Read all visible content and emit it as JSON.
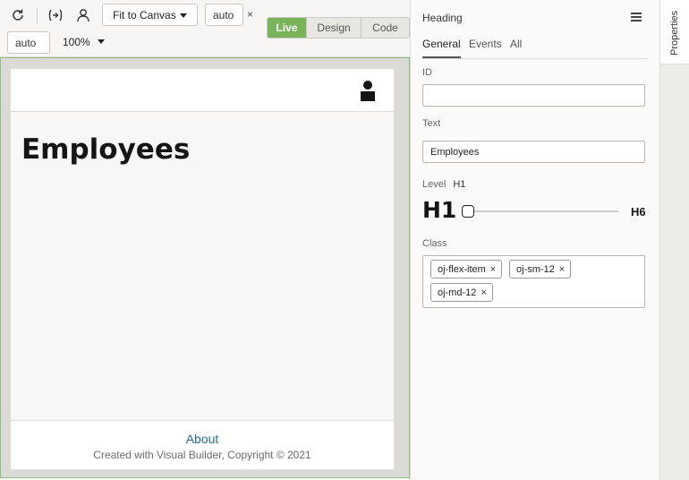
{
  "toolbar": {
    "fit_label": "Fit to Canvas",
    "width_value": "auto",
    "height_value": "auto",
    "times": "×",
    "zoom": "100%",
    "modes": [
      "Live",
      "Design",
      "Code"
    ],
    "active_mode": "Live",
    "accent": "#7ab45a"
  },
  "canvas": {
    "heading": "Employees",
    "footer_link": "About",
    "copyright": "Created with Visual Builder, Copyright © 2021"
  },
  "properties": {
    "title": "Heading",
    "tabs": [
      "General",
      "Events",
      "All"
    ],
    "active_tab": "General",
    "id_label": "ID",
    "id_value": "",
    "text_label": "Text",
    "text_value": "Employees",
    "level_label": "Level",
    "level_value": "H1",
    "level_min": "H1",
    "level_max": "H6",
    "class_label": "Class",
    "classes": [
      "oj-flex-item",
      "oj-sm-12",
      "oj-md-12"
    ],
    "chip_remove": "×"
  },
  "side_tab": "Properties"
}
